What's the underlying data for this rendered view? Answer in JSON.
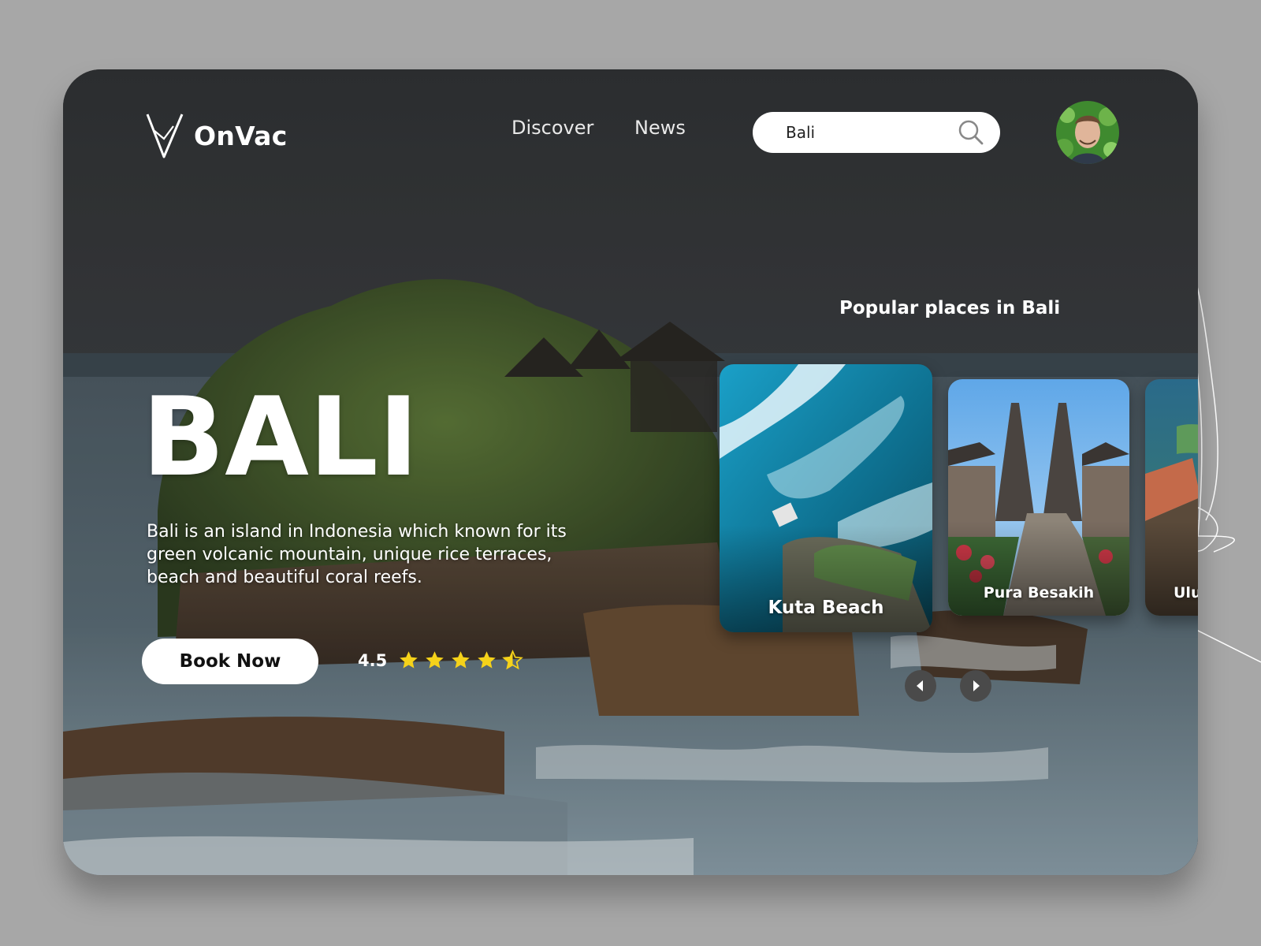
{
  "header": {
    "logo_text": "OnVac",
    "nav": {
      "discover": "Discover",
      "news": "News"
    },
    "search": {
      "value": "Bali",
      "icon": "search-icon"
    },
    "avatar_icon": "user-avatar"
  },
  "hero": {
    "title": "BALI",
    "description": "Bali is an island in Indonesia which known for its green volcanic mountain, unique rice terraces, beach and beautiful coral reefs.",
    "book_button": "Book Now",
    "rating": {
      "value": "4.5",
      "stars": 4.5,
      "max": 5
    }
  },
  "popular": {
    "title": "Popular places in Bali",
    "places": [
      {
        "label": "Kuta Beach"
      },
      {
        "label": "Pura Besakih"
      },
      {
        "label": "Ulu"
      }
    ],
    "prev_icon": "chevron-left-icon",
    "next_icon": "chevron-right-icon"
  },
  "colors": {
    "background": "#a7a7a7",
    "accent_star": "#f5d21a",
    "button_bg": "#ffffff",
    "text_on_image": "#ffffff"
  }
}
